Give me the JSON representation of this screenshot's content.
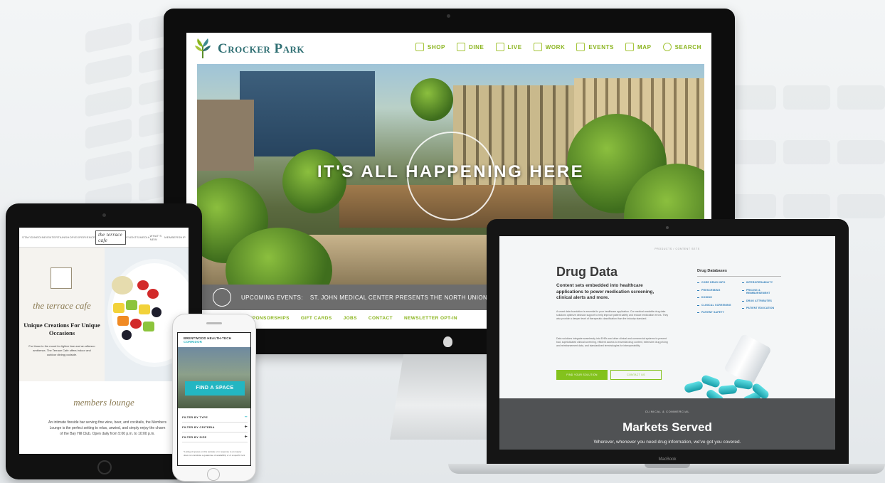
{
  "imac": {
    "site": {
      "logo": "Crocker Park",
      "nav": [
        {
          "label": "SHOP",
          "icon": "bag-icon"
        },
        {
          "label": "DINE",
          "icon": "fork-icon"
        },
        {
          "label": "LIVE",
          "icon": "bed-icon"
        },
        {
          "label": "WORK",
          "icon": "monitor-icon"
        },
        {
          "label": "EVENTS",
          "icon": "calendar-icon"
        },
        {
          "label": "MAP",
          "icon": "map-icon"
        },
        {
          "label": "SEARCH",
          "icon": "search-icon"
        }
      ],
      "hero_headline": "IT'S ALL HAPPENING HERE",
      "events_label": "UPCOMING EVENTS:",
      "events_ticker": "ST. JOHN MEDICAL CENTER PRESENTS THE NORTH UNION FARMERS MARKET —",
      "footer_links": [
        "SPONSORSHIPS",
        "GIFT CARDS",
        "JOBS",
        "CONTACT",
        "NEWSLETTER OPT-IN"
      ]
    }
  },
  "ipad": {
    "nav": [
      "STAY/DINE",
      "DINE/ENTERTAIN",
      "SHOP/EXPERIENCE",
      "the terrace cafe",
      "EVENTS/MEDIA",
      "WHAT'S NEW",
      "MEMBERSHIP"
    ],
    "cafe_script": "the terrace cafe",
    "cafe_title": "Unique Creations For Unique Occasions",
    "cafe_body": "For those in the mood for lighter fare and an alfresco ambience, The Terrace Cafe offers indoor and outdoor dining poolside.",
    "lounge_script": "members lounge",
    "lounge_body": "An intimate fireside bar serving fine wine, beer, and cocktails, the Members Lounge is the perfect setting to relax, unwind, and simply enjoy the charm of the Bay Hill Club. Open daily from 5:00 p.m. to 10:00 p.m."
  },
  "iphone": {
    "logo_line1": "BRENTWOOD HEALTH-TECH",
    "logo_line2": "CORRIDOR",
    "cta": "FIND A SPACE",
    "filters": [
      {
        "label": "FILTER BY TYPE",
        "sign": "–"
      },
      {
        "label": "FILTER BY CRITERIA",
        "sign": "+"
      },
      {
        "label": "FILTER BY SIZE",
        "sign": "+"
      }
    ],
    "body": "*Listing of spaces on this website or in response to an inquiry does not constitute a guarantee of availability or of a specific rent"
  },
  "macbook": {
    "brand": "MacBook",
    "page": {
      "top_label": "PRODUCTS / CONTENT SETS",
      "title": "Drug Data",
      "lead": "Content sets embedded into healthcare applications to power medication screening, clinical alerts and more.",
      "para1": "A smart data foundation is essential to your healthcare application. Our medical-readable drug data solutions optimize decision support to help improve patient safety and reduce medication errors. They also provide a deeper level of therapeutic classification than the industry standard.",
      "para2": "Data solutions integrate seamlessly into EHRs and other clinical and commercial systems to prevent bad, sophisticated clinical screening, efficient access to essential drug content, extensive drug pricing and reimbursement data, and standardized terminologies for interoperability.",
      "primary_button": "FIND YOUR SOLUTION",
      "secondary_button": "CONTACT US",
      "sidebar_title": "Drug Databases",
      "sidebar_col1": [
        "CORE DRUG INFO",
        "PRESCRIBING",
        "DOSING",
        "CLINICAL SCREENING",
        "PATIENT SAFETY"
      ],
      "sidebar_col2": [
        "INTEROPERABILITY",
        "PRICING & REIMBURSEMENT",
        "DRUG ATTRIBUTES",
        "PATIENT EDUCATION"
      ],
      "markets_label": "CLINICAL & COMMERCIAL",
      "markets_title": "Markets Served",
      "markets_sub": "Wherever, whenever you need drug information, we've got you covered."
    }
  }
}
